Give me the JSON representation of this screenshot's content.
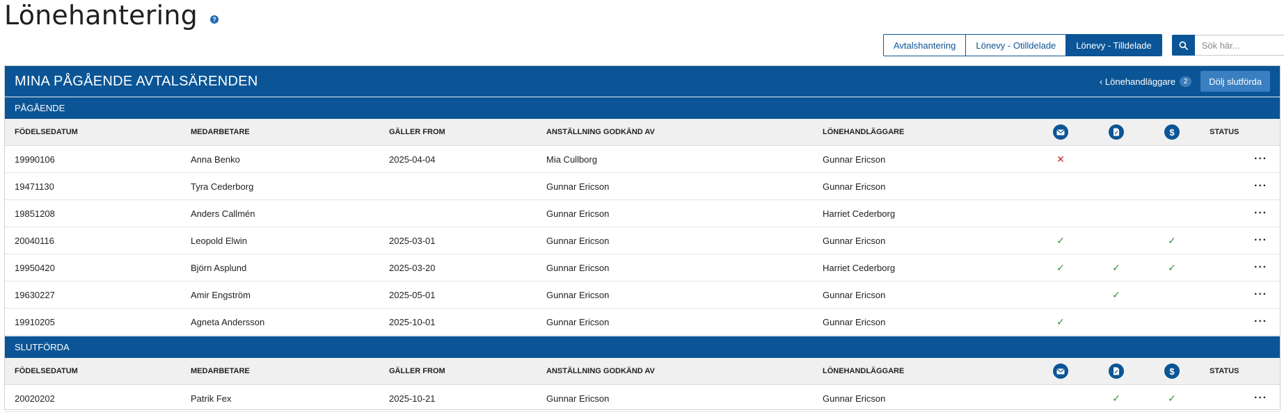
{
  "page": {
    "title": "Lönehantering",
    "help_icon": "?"
  },
  "toolbar": {
    "tabs": [
      {
        "label": "Avtalshantering",
        "active": false
      },
      {
        "label": "Lönevy - Otilldelade",
        "active": false
      },
      {
        "label": "Lönevy - Tilldelade",
        "active": true
      }
    ],
    "search": {
      "placeholder": "Sök här..."
    }
  },
  "panel": {
    "title": "MINA PÅGÅENDE AVTALSÄRENDEN",
    "handlers_label": "‹ Lönehandläggare",
    "handlers_count": "2",
    "hide_button": "Dölj slutförda"
  },
  "columns": {
    "birth": "FÖDELSEDATUM",
    "employee": "MEDARBETARE",
    "valid_from": "GÄLLER FROM",
    "approved_by": "ANSTÄLLNING GODKÄND AV",
    "handler": "LÖNEHANDLÄGGARE",
    "status": "STATUS",
    "icons": [
      "envelope-icon",
      "document-icon",
      "dollar-icon"
    ]
  },
  "sections": {
    "ongoing": "PÅGÅENDE",
    "finished": "SLUTFÖRDA"
  },
  "marks": {
    "check": "✓",
    "cross": "✕",
    "more": "···"
  },
  "colors": {
    "primary": "#0b5596",
    "check": "#2e8b3a",
    "cross": "#c62828"
  },
  "ongoing_rows": [
    {
      "birth": "19990106",
      "employee": "Anna Benko",
      "valid_from": "2025-04-04",
      "approved_by": "Mia Cullborg",
      "handler": "Gunnar Ericson",
      "mail": "cross",
      "doc": "",
      "pay": ""
    },
    {
      "birth": "19471130",
      "employee": "Tyra Cederborg",
      "valid_from": "",
      "approved_by": "Gunnar Ericson",
      "handler": "Gunnar Ericson",
      "mail": "",
      "doc": "",
      "pay": ""
    },
    {
      "birth": "19851208",
      "employee": "Anders Callmén",
      "valid_from": "",
      "approved_by": "Gunnar Ericson",
      "handler": "Harriet Cederborg",
      "mail": "",
      "doc": "",
      "pay": ""
    },
    {
      "birth": "20040116",
      "employee": "Leopold Elwin",
      "valid_from": "2025-03-01",
      "approved_by": "Gunnar Ericson",
      "handler": "Gunnar Ericson",
      "mail": "check",
      "doc": "",
      "pay": "check"
    },
    {
      "birth": "19950420",
      "employee": "Björn Asplund",
      "valid_from": "2025-03-20",
      "approved_by": "Gunnar Ericson",
      "handler": "Harriet Cederborg",
      "mail": "check",
      "doc": "check",
      "pay": "check"
    },
    {
      "birth": "19630227",
      "employee": "Amir Engström",
      "valid_from": "2025-05-01",
      "approved_by": "Gunnar Ericson",
      "handler": "Gunnar Ericson",
      "mail": "",
      "doc": "check",
      "pay": ""
    },
    {
      "birth": "19910205",
      "employee": "Agneta Andersson",
      "valid_from": "2025-10-01",
      "approved_by": "Gunnar Ericson",
      "handler": "Gunnar Ericson",
      "mail": "check",
      "doc": "",
      "pay": ""
    }
  ],
  "finished_rows": [
    {
      "birth": "20020202",
      "employee": "Patrik Fex",
      "valid_from": "2025-10-21",
      "approved_by": "Gunnar Ericson",
      "handler": "Gunnar Ericson",
      "mail": "",
      "doc": "check",
      "pay": "check"
    }
  ]
}
